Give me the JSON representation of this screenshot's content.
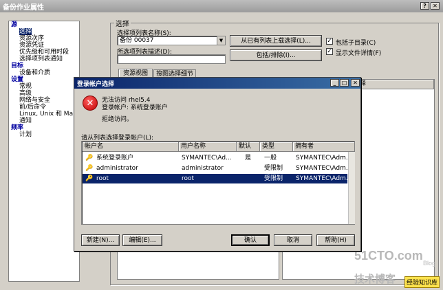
{
  "main_window": {
    "title": "备份作业属性"
  },
  "sidebar": {
    "sections": [
      {
        "label": "源",
        "items": [
          "选择",
          "资源次序",
          "资源凭证",
          "优先级和可用时段",
          "选择项列表通知"
        ]
      },
      {
        "label": "目标",
        "items": [
          "设备和介质"
        ]
      },
      {
        "label": "设置",
        "items": [
          "常规",
          "高级",
          "网络与安全",
          "前/后命令",
          "Linux, Unix 和 Ma",
          "通知"
        ]
      },
      {
        "label": "频率",
        "items": [
          "计划"
        ]
      }
    ],
    "selected": "选择"
  },
  "selection_panel": {
    "group_label": "选择",
    "list_name_label": "选择项列表名称(S):",
    "list_name_value": "备份 00037",
    "desc_label": "所选项列表描述(D):",
    "desc_value": "",
    "load_button": "从已有列表上载选择(L)...",
    "include_button": "包括/排除(I)...",
    "include_subdirs_label": "包括子目录(C)",
    "include_subdirs_checked": true,
    "show_details_label": "显示文件详情(F)",
    "show_details_checked": true,
    "tabs": [
      "资源视图",
      "搜图选择细节"
    ],
    "right_col_header": "择"
  },
  "dialog": {
    "title": "登录帐户选择",
    "error_line1": "无法访问 rhel5.4",
    "error_line2": "登录帐户: 系统登录账户",
    "error_line3": "拒绝访问。",
    "list_label": "请从列表选择登录帐户(L):",
    "columns": [
      "帐户名",
      "用户名称",
      "默认",
      "类型",
      "拥有者"
    ],
    "rows": [
      {
        "account": "系统登录账户",
        "user": "SYMANTEC\\Ad...",
        "default": "是",
        "type": "一般",
        "owner": "SYMANTEC\\Adm...",
        "selected": false
      },
      {
        "account": "administrator",
        "user": "administrator",
        "default": "",
        "type": "受限制",
        "owner": "SYMANTEC\\Adm...",
        "selected": false
      },
      {
        "account": "root",
        "user": "root",
        "default": "",
        "type": "受限制",
        "owner": "SYMANTEC\\Adm...",
        "selected": true
      }
    ],
    "buttons": {
      "new": "新建(N)...",
      "edit": "编辑(E)...",
      "ok": "确认",
      "cancel": "取消",
      "help": "帮助(H)"
    }
  },
  "watermark": {
    "site": "51CTO.com",
    "line2": "技术博客",
    "line3": "Blog",
    "badge": "经验知识库"
  }
}
